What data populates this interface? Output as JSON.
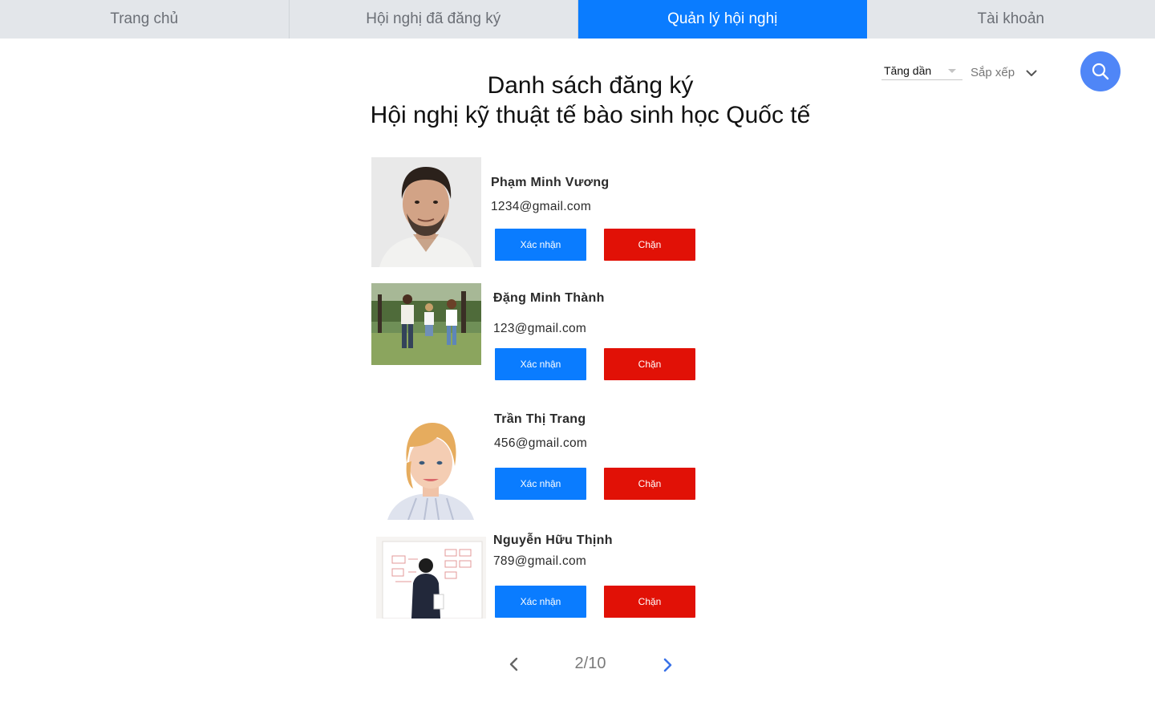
{
  "nav": {
    "tabs": [
      {
        "label": "Trang chủ",
        "active": false
      },
      {
        "label": "Hội nghị đã đăng ký",
        "active": false
      },
      {
        "label": "Quản lý hội nghị",
        "active": true
      },
      {
        "label": "Tài khoản",
        "active": false
      }
    ]
  },
  "header": {
    "title_line1": "Danh sách đăng ký",
    "title_line2": "Hội nghị kỹ thuật tế bào sinh học Quốc tế"
  },
  "sort": {
    "order_value": "Tăng dần",
    "label": "Sắp xếp"
  },
  "registrants": [
    {
      "name": "Phạm Minh Vương",
      "email": "1234@gmail.com",
      "confirm_label": "Xác nhận",
      "block_label": "Chặn"
    },
    {
      "name": "Đặng Minh Thành",
      "email": "123@gmail.com",
      "confirm_label": "Xác nhận",
      "block_label": "Chặn"
    },
    {
      "name": "Trần Thị Trang",
      "email": "456@gmail.com",
      "confirm_label": "Xác nhận",
      "block_label": "Chặn"
    },
    {
      "name": "Nguyễn Hữu Thịnh",
      "email": "789@gmail.com",
      "confirm_label": "Xác nhận",
      "block_label": "Chặn"
    }
  ],
  "pagination": {
    "indicator": "2/10"
  },
  "colors": {
    "primary": "#0a7cff",
    "danger": "#e11106",
    "search": "#4f86f7",
    "tab_inactive": "#e3e6ea"
  },
  "icons": {
    "search": "search-icon",
    "sort_toggle": "chevron-down-icon",
    "prev": "chevron-left-icon",
    "next": "chevron-right-icon"
  }
}
